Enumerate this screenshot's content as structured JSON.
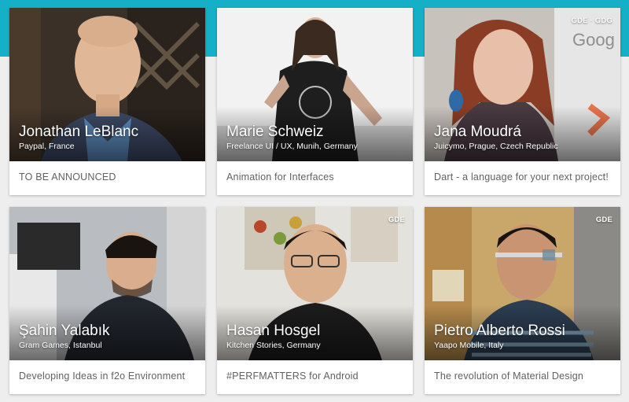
{
  "colors": {
    "accent": "#15b0c8",
    "card_background": "#ffffff",
    "page_background": "#eeeeee",
    "talk_text": "#616161"
  },
  "speakers": [
    {
      "name": "Jonathan LeBlanc",
      "company": "Paypal, France",
      "talk": "TO BE ANNOUNCED",
      "badge": ""
    },
    {
      "name": "Marie Schweiz",
      "company": "Freelance UI / UX, Munih, Germany",
      "talk": "Animation for Interfaces",
      "badge": ""
    },
    {
      "name": "Jana Moudrá",
      "company": "Juicymo, Prague, Czech Republic",
      "talk": "Dart - a language for your next project!",
      "badge": "GDE · GDG"
    },
    {
      "name": "Şahin Yalabık",
      "company": "Gram Games, Istanbul",
      "talk": "Developing Ideas in f2o Environment",
      "badge": ""
    },
    {
      "name": "Hasan Hosgel",
      "company": "Kitchen Stories, Germany",
      "talk": "#PERFMATTERS for Android",
      "badge": "GDE"
    },
    {
      "name": "Pietro Alberto Rossi",
      "company": "Yaapo Mobile, Italy",
      "talk": "The revolution of Material Design",
      "badge": "GDE"
    }
  ]
}
